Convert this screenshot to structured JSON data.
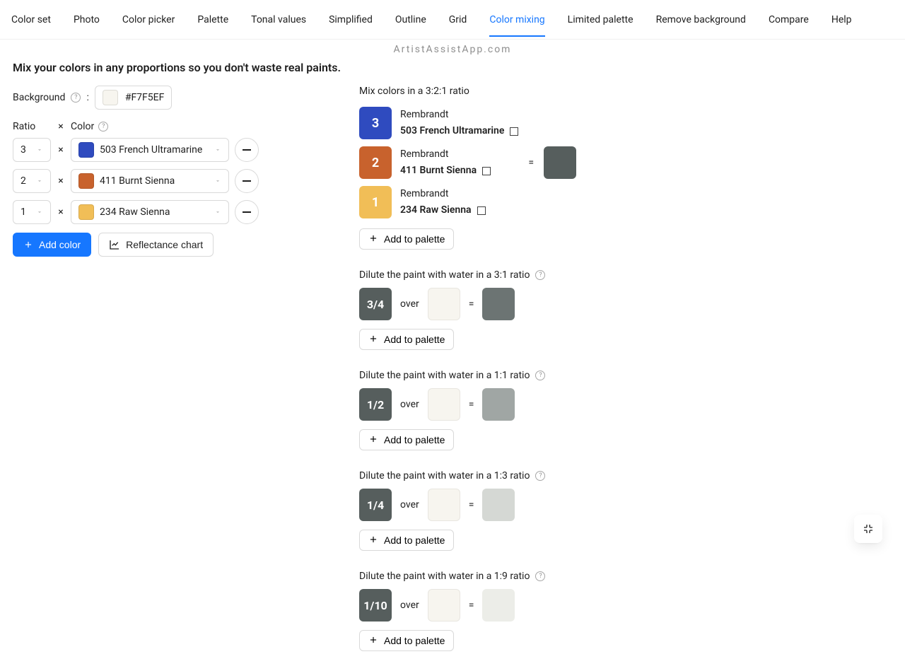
{
  "brand": "ArtistAssistApp.com",
  "tabs": [
    "Color set",
    "Photo",
    "Color picker",
    "Palette",
    "Tonal values",
    "Simplified",
    "Outline",
    "Grid",
    "Color mixing",
    "Limited palette",
    "Remove background",
    "Compare",
    "Help"
  ],
  "activeTab": "Color mixing",
  "heading": "Mix your colors in any proportions so you don't waste real paints.",
  "left": {
    "background_label": "Background",
    "background_hex": "#F7F5EF",
    "labels": {
      "ratio": "Ratio",
      "x": "×",
      "color": "Color"
    },
    "rows": [
      {
        "ratio": "3",
        "swatch": "#2f4bbf",
        "name": "503 French Ultramarine"
      },
      {
        "ratio": "2",
        "swatch": "#c8622d",
        "name": "411 Burnt Sienna"
      },
      {
        "ratio": "1",
        "swatch": "#f1be57",
        "name": "234 Raw Sienna"
      }
    ],
    "add_color": "Add color",
    "reflectance": "Reflectance chart"
  },
  "right": {
    "mix_title": "Mix colors in a 3:2:1 ratio",
    "brand": "Rembrandt",
    "parts": [
      {
        "ratio": "3",
        "box_color": "#2f4bbf",
        "name": "503 French Ultramarine"
      },
      {
        "ratio": "2",
        "box_color": "#c8622d",
        "name": "411 Burnt Sienna"
      },
      {
        "ratio": "1",
        "box_color": "#f1be57",
        "name": "234 Raw Sienna"
      }
    ],
    "eq": "=",
    "mix_result_color": "#565e5d",
    "add_palette": "Add to palette",
    "dilutes": [
      {
        "title": "Dilute the paint with water in a 3:1 ratio",
        "frac": "3/4",
        "box_color": "#565e5d",
        "result": "#6c7473"
      },
      {
        "title": "Dilute the paint with water in a 1:1 ratio",
        "frac": "1/2",
        "box_color": "#565e5d",
        "result": "#a0a6a4"
      },
      {
        "title": "Dilute the paint with water in a 1:3 ratio",
        "frac": "1/4",
        "box_color": "#565e5d",
        "result": "#d5d8d4"
      },
      {
        "title": "Dilute the paint with water in a 1:9 ratio",
        "frac": "1/10",
        "box_color": "#565e5d",
        "result": "#ecede8"
      }
    ],
    "over": "over",
    "bg_swatch": "#F7F5EF"
  }
}
